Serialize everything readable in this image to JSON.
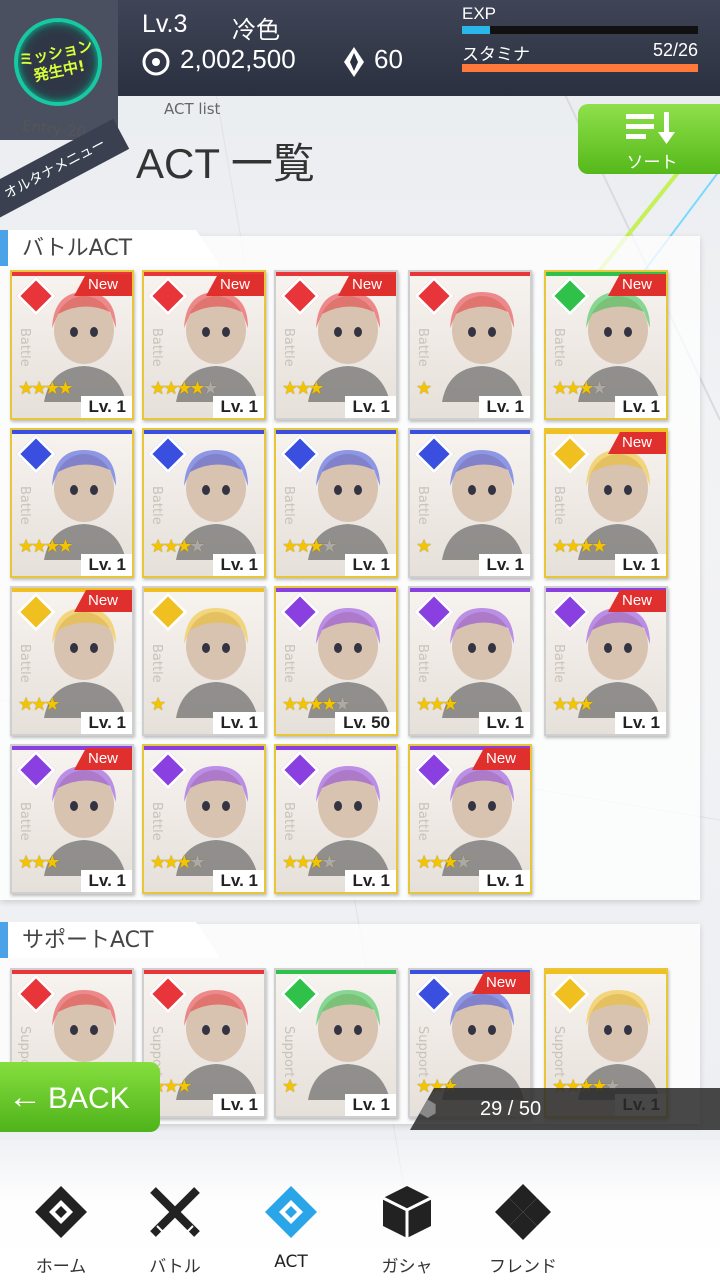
{
  "header": {
    "level": "Lv.3",
    "username": "冷色",
    "coins": "2,002,500",
    "gems": "60",
    "exp_label": "EXP",
    "exp_progress": 0.12,
    "stamina_label": "スタミナ",
    "stamina_value": "52/26",
    "stamina_progress": 1.0
  },
  "mission": {
    "line1": "ミッション",
    "line2": "発生中!",
    "entry": "Entry-20",
    "alt_menu": "オルタナメニュー"
  },
  "page": {
    "subtitle": "ACT list",
    "title": "ACT 一覧",
    "sort_label": "ソート"
  },
  "sections": {
    "battle_label": "バトルACT",
    "support_label": "サポートACT",
    "battle_side": "Battle",
    "support_side": "Support",
    "new_label": "New"
  },
  "colors": {
    "red": "#e8353a",
    "blue": "#3a4fe0",
    "green": "#2fc14a",
    "yellow": "#f0c020",
    "purple": "#8a3fe0"
  },
  "battle_cards": [
    {
      "attr": "red",
      "new": true,
      "stars": 4,
      "max": 4,
      "lv": "Lv. 1"
    },
    {
      "attr": "red",
      "new": true,
      "stars": 4,
      "max": 5,
      "lv": "Lv. 1"
    },
    {
      "attr": "red",
      "new": true,
      "stars": 3,
      "max": 3,
      "lv": "Lv. 1"
    },
    {
      "attr": "red",
      "new": false,
      "stars": 1,
      "max": 1,
      "lv": "Lv. 1"
    },
    {
      "attr": "green",
      "new": true,
      "stars": 3,
      "max": 4,
      "lv": "Lv. 1"
    },
    {
      "attr": "blue",
      "new": false,
      "stars": 4,
      "max": 4,
      "lv": "Lv. 1"
    },
    {
      "attr": "blue",
      "new": false,
      "stars": 3,
      "max": 4,
      "lv": "Lv. 1"
    },
    {
      "attr": "blue",
      "new": false,
      "stars": 3,
      "max": 4,
      "lv": "Lv. 1"
    },
    {
      "attr": "blue",
      "new": false,
      "stars": 1,
      "max": 1,
      "lv": "Lv. 1"
    },
    {
      "attr": "yellow",
      "new": true,
      "stars": 4,
      "max": 4,
      "lv": "Lv. 1"
    },
    {
      "attr": "yellow",
      "new": true,
      "stars": 3,
      "max": 3,
      "lv": "Lv. 1"
    },
    {
      "attr": "yellow",
      "new": false,
      "stars": 1,
      "max": 1,
      "lv": "Lv. 1"
    },
    {
      "attr": "purple",
      "new": false,
      "stars": 4,
      "max": 5,
      "lv": "Lv. 50"
    },
    {
      "attr": "purple",
      "new": false,
      "stars": 3,
      "max": 3,
      "lv": "Lv. 1"
    },
    {
      "attr": "purple",
      "new": true,
      "stars": 3,
      "max": 3,
      "lv": "Lv. 1"
    },
    {
      "attr": "purple",
      "new": true,
      "stars": 3,
      "max": 3,
      "lv": "Lv. 1"
    },
    {
      "attr": "purple",
      "new": false,
      "stars": 3,
      "max": 4,
      "lv": "Lv. 1"
    },
    {
      "attr": "purple",
      "new": false,
      "stars": 3,
      "max": 4,
      "lv": "Lv. 1"
    },
    {
      "attr": "purple",
      "new": true,
      "stars": 3,
      "max": 4,
      "lv": "Lv. 1"
    }
  ],
  "support_cards": [
    {
      "attr": "red",
      "new": false,
      "stars": 0,
      "max": 0,
      "lv": ""
    },
    {
      "attr": "red",
      "new": false,
      "stars": 3,
      "max": 3,
      "lv": "Lv. 1"
    },
    {
      "attr": "green",
      "new": false,
      "stars": 1,
      "max": 1,
      "lv": "Lv. 1"
    },
    {
      "attr": "blue",
      "new": true,
      "stars": 3,
      "max": 3,
      "lv": ""
    },
    {
      "attr": "yellow",
      "new": false,
      "stars": 4,
      "max": 5,
      "lv": "Lv. 1"
    }
  ],
  "back_label": "BACK",
  "count": "29 / 50",
  "nav": [
    {
      "label": "ホーム",
      "icon": "home-icon"
    },
    {
      "label": "バトル",
      "icon": "battle-icon"
    },
    {
      "label": "ACT",
      "icon": "act-icon"
    },
    {
      "label": "ガシャ",
      "icon": "gacha-icon"
    },
    {
      "label": "フレンド",
      "icon": "friend-icon"
    }
  ]
}
